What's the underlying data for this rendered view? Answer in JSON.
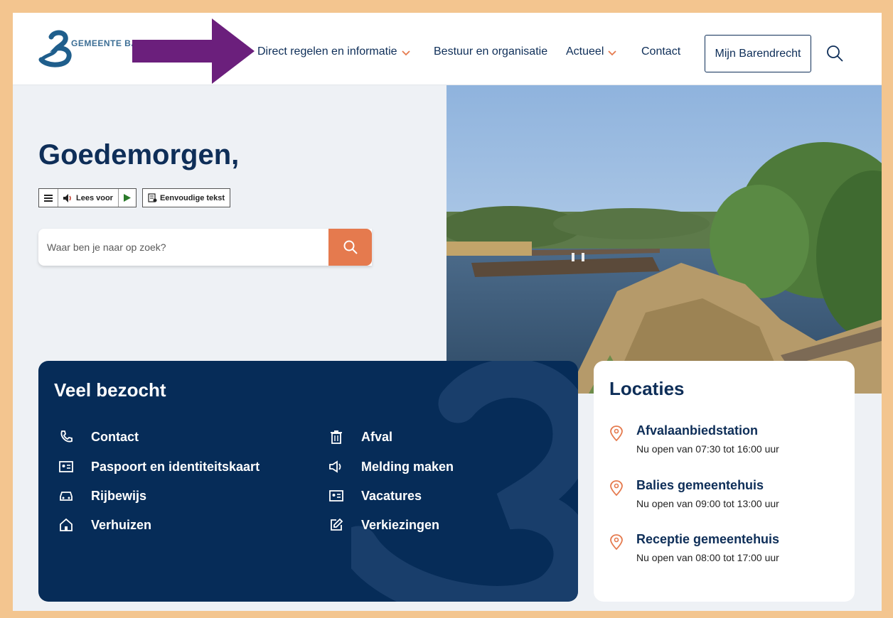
{
  "header": {
    "logo_text": "GEMEENTE BARENDRECHT",
    "nav": [
      {
        "label": "Direct regelen en informatie",
        "has_dropdown": true
      },
      {
        "label": "Bestuur en organisatie",
        "has_dropdown": false
      },
      {
        "label": "Actueel",
        "has_dropdown": true
      },
      {
        "label": "Contact",
        "has_dropdown": false
      }
    ],
    "account_button": "Mijn Barendrecht",
    "search_icon": "search-icon"
  },
  "hero": {
    "greeting": "Goedemorgen,",
    "readspeaker": {
      "menu_icon": "menu-icon",
      "read_label": "Lees voor",
      "play_icon": "play-icon",
      "simple_text_label": "Eenvoudige tekst"
    },
    "search": {
      "placeholder": "Waar ben je naar op zoek?",
      "button_icon": "search-icon"
    }
  },
  "veel_bezocht": {
    "title": "Veel bezocht",
    "links_left": [
      {
        "label": "Contact",
        "icon": "phone-icon"
      },
      {
        "label": "Paspoort en identiteitskaart",
        "icon": "id-card-icon"
      },
      {
        "label": "Rijbewijs",
        "icon": "car-icon"
      },
      {
        "label": "Verhuizen",
        "icon": "home-icon"
      }
    ],
    "links_right": [
      {
        "label": "Afval",
        "icon": "trash-icon"
      },
      {
        "label": "Melding maken",
        "icon": "megaphone-icon"
      },
      {
        "label": "Vacatures",
        "icon": "id-card-icon"
      },
      {
        "label": "Verkiezingen",
        "icon": "edit-icon"
      }
    ]
  },
  "locaties": {
    "title": "Locaties",
    "items": [
      {
        "name": "Afvalaanbiedstation",
        "hours": "Nu open van 07:30 tot 16:00 uur"
      },
      {
        "name": "Balies gemeentehuis",
        "hours": "Nu open van 09:00 tot 13:00 uur"
      },
      {
        "name": "Receptie gemeentehuis",
        "hours": "Nu open van 08:00 tot 17:00 uur"
      }
    ]
  },
  "colors": {
    "navy": "#0e2e58",
    "dark_panel": "#062c58",
    "accent_orange": "#e57a4e",
    "frame_border": "#f3c58f",
    "annotation_arrow": "#6b1f7c"
  }
}
